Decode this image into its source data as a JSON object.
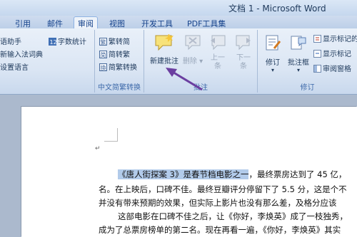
{
  "window": {
    "title": "文档 1 - Microsoft Word"
  },
  "tabs": [
    {
      "label": "引用"
    },
    {
      "label": "邮件"
    },
    {
      "label": "审阅"
    },
    {
      "label": "视图"
    },
    {
      "label": "开发工具"
    },
    {
      "label": "PDF工具集"
    }
  ],
  "ribbon": {
    "proofing": {
      "items": [
        "语助手",
        "新输入法词典",
        "设置语言"
      ],
      "word_count": "字数统计"
    },
    "chinese_conversion": {
      "items": [
        "繁转简",
        "简转繁",
        "简繁转换"
      ],
      "group_label": "中文简繁转换"
    },
    "comments": {
      "new": "新建批注",
      "delete": "删除",
      "prev_1": "上一",
      "prev_2": "条",
      "next_1": "下一",
      "next_2": "条",
      "group_label": "批注"
    },
    "tracking": {
      "track_changes": "修订",
      "balloons": "批注框",
      "display": "显示标记的",
      "show_markup": "显示标记",
      "reviewing_pane": "审阅窗格",
      "group_label": "修订"
    }
  },
  "document": {
    "lines": [
      {
        "highlight": "《唐人街探案 3》是春节档电影之一",
        "text": "，最终票房达到了 45 亿，"
      },
      {
        "text": "名。在上映后，口碑不佳。最终豆瓣评分停留下了 5.5 分，这是个不"
      },
      {
        "text": "并没有带来预期的效果，但实际上影片也没有那么差，及格分应该"
      },
      {
        "text": "这部电影在口碑不佳之后，让《你好，李焕英》成了一枝独秀，"
      },
      {
        "text": "成为了总票房榜单的第二名。现在再看一遍，《你好，李焕英》其实"
      }
    ]
  },
  "colors": {
    "accent": "#6b3fa0",
    "highlight": "#b2cbea"
  },
  "annotation": {
    "type": "arrow"
  }
}
